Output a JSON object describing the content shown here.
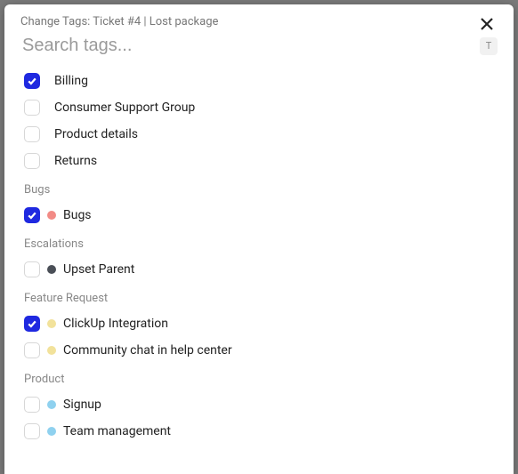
{
  "header": {
    "title": "Change Tags: Ticket #4 | Lost package"
  },
  "search": {
    "placeholder": "Search tags...",
    "value": "",
    "shortcut": "T"
  },
  "groups": [
    {
      "name": null,
      "items": [
        {
          "label": "Billing",
          "checked": true,
          "dot": null
        },
        {
          "label": "Consumer Support Group",
          "checked": false,
          "dot": null
        },
        {
          "label": "Product details",
          "checked": false,
          "dot": null
        },
        {
          "label": "Returns",
          "checked": false,
          "dot": null
        }
      ]
    },
    {
      "name": "Bugs",
      "items": [
        {
          "label": "Bugs",
          "checked": true,
          "dot": "#f28b86"
        }
      ]
    },
    {
      "name": "Escalations",
      "items": [
        {
          "label": "Upset Parent",
          "checked": false,
          "dot": "#4a4f57"
        }
      ]
    },
    {
      "name": "Feature Request",
      "items": [
        {
          "label": "ClickUp Integration",
          "checked": true,
          "dot": "#f2e29b"
        },
        {
          "label": "Community chat in help center",
          "checked": false,
          "dot": "#f2e29b"
        }
      ]
    },
    {
      "name": "Product",
      "items": [
        {
          "label": "Signup",
          "checked": false,
          "dot": "#8fd1ef"
        },
        {
          "label": "Team management",
          "checked": false,
          "dot": "#8fd1ef"
        }
      ]
    }
  ]
}
